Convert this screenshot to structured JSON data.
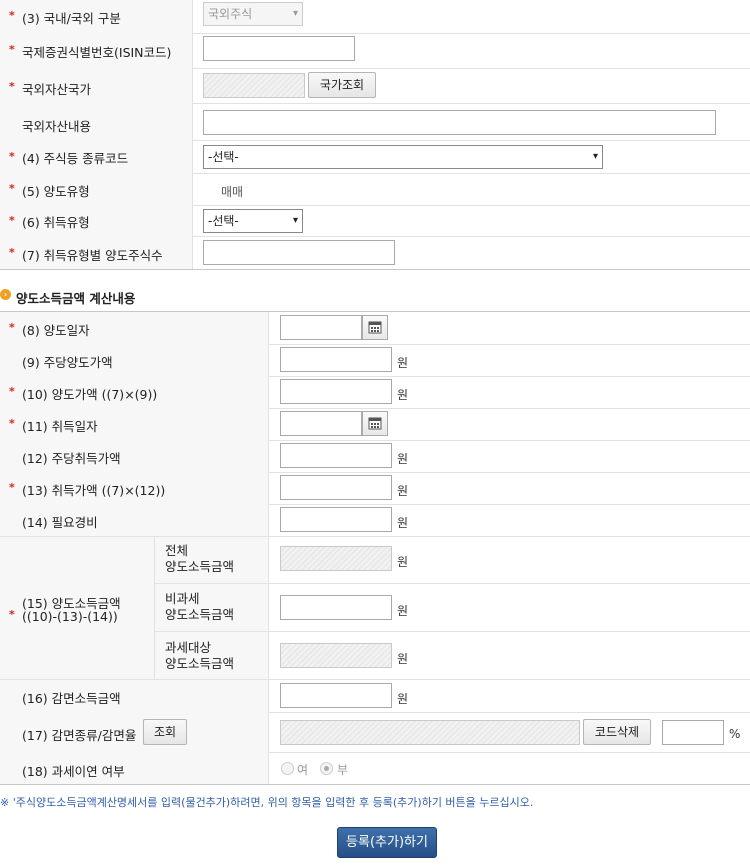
{
  "form_top": {
    "r3": {
      "label": "(3) 국내/국외 구분",
      "select": "국외주식"
    },
    "isin": {
      "label": "국제증권식별번호(ISIN코드)",
      "value": ""
    },
    "country": {
      "label": "국외자산국가",
      "button": "국가조회"
    },
    "content": {
      "label": "국외자산내용",
      "value": ""
    },
    "r4": {
      "label": "(4) 주식등 종류코드",
      "select": "-선택-"
    },
    "r5": {
      "label": "(5) 양도유형",
      "value": "매매"
    },
    "r6": {
      "label": "(6) 취득유형",
      "select": "-선택-"
    },
    "r7": {
      "label": "(7) 취득유형별 양도주식수",
      "value": ""
    }
  },
  "section_title": "양도소득금액 계산내용",
  "calc": {
    "r8": "(8) 양도일자",
    "r9": "(9) 주당양도가액",
    "r10": "(10) 양도가액 ((7)×(9))",
    "r11": "(11) 취득일자",
    "r12": "(12) 주당취득가액",
    "r13": "(13) 취득가액 ((7)×(12))",
    "r14": "(14) 필요경비",
    "r15_line1": "(15) 양도소득금액",
    "r15_line2": "((10)-(13)-(14))",
    "r15_sub1_a": "전체",
    "r15_sub1_b": "양도소득금액",
    "r15_sub2_a": "비과세",
    "r15_sub2_b": "양도소득금액",
    "r15_sub3_a": "과세대상",
    "r15_sub3_b": "양도소득금액",
    "r16": "(16) 감면소득금액",
    "r17": "(17) 감면종류/감면율",
    "r17_lookup": "조회",
    "r17_delete": "코드삭제",
    "r17_pct": "%",
    "r18": "(18) 과세이연 여부",
    "r18_yes": "여",
    "r18_no": "부",
    "won": "원"
  },
  "note": "※ '주식양도소득금액계산명세서를 입력(물건추가)하려면, 위의 항목을 입력한 후 등록(추가)하기 버튼을 누르십시오.",
  "submit": "등록(추가)하기",
  "colors": {
    "required": "#e0201b",
    "submit_bg": "#2e5c95",
    "section_icon": "#f0a020"
  }
}
